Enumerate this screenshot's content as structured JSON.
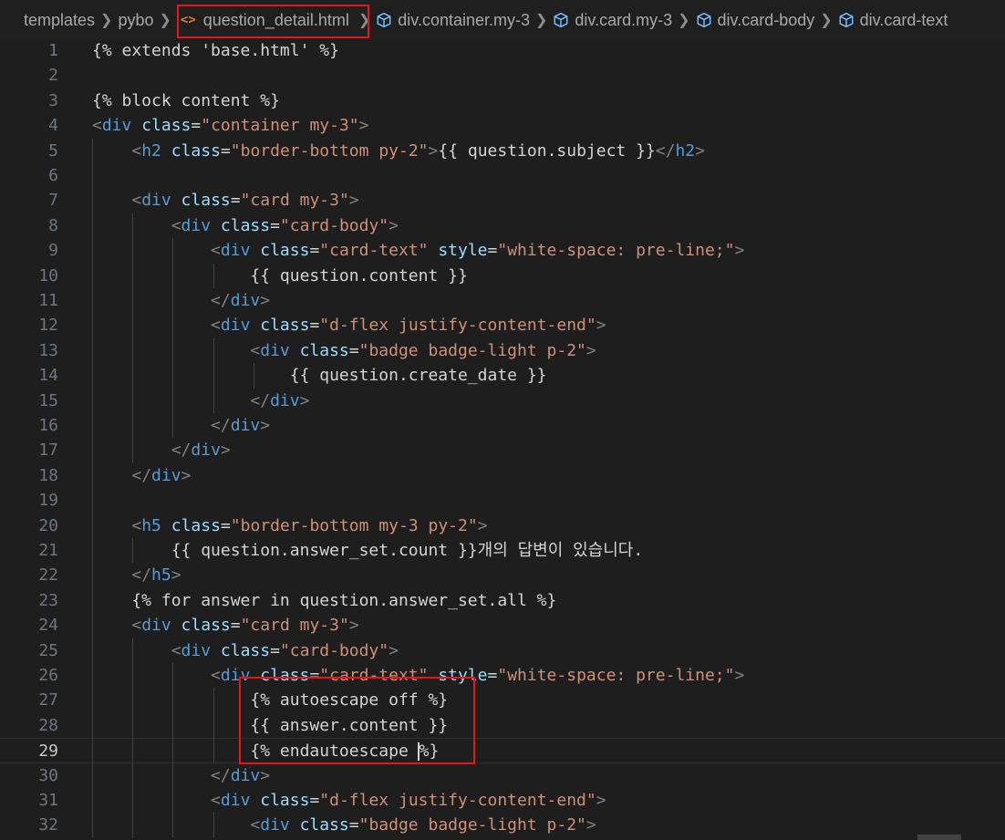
{
  "breadcrumb": {
    "items": [
      {
        "label": "templates",
        "icon": ""
      },
      {
        "label": "pybo",
        "icon": ""
      },
      {
        "label": "question_detail.html",
        "icon": "html-file-icon"
      },
      {
        "label": "div.container.my-3",
        "icon": "element-cube-icon"
      },
      {
        "label": "div.card.my-3",
        "icon": "element-cube-icon"
      },
      {
        "label": "div.card-body",
        "icon": "element-cube-icon"
      },
      {
        "label": "div.card-text",
        "icon": "element-cube-icon"
      }
    ]
  },
  "editor": {
    "active_line": 29,
    "lines": [
      {
        "n": "1",
        "tokens": [
          {
            "t": "{% extends 'base.html' %}",
            "c": "tpl"
          }
        ]
      },
      {
        "n": "2",
        "tokens": []
      },
      {
        "n": "3",
        "tokens": [
          {
            "t": "{% block content %}",
            "c": "tpl"
          }
        ]
      },
      {
        "n": "4",
        "tokens": [
          {
            "t": "<",
            "c": "ang"
          },
          {
            "t": "div",
            "c": "tag"
          },
          {
            "t": " class",
            "c": "attr"
          },
          {
            "t": "=",
            "c": "tpl"
          },
          {
            "t": "\"container my-3\"",
            "c": "str"
          },
          {
            "t": ">",
            "c": "ang"
          }
        ]
      },
      {
        "n": "5",
        "tokens": [
          {
            "t": "    ",
            "c": "tpl"
          },
          {
            "t": "<",
            "c": "ang"
          },
          {
            "t": "h2",
            "c": "tag"
          },
          {
            "t": " class",
            "c": "attr"
          },
          {
            "t": "=",
            "c": "tpl"
          },
          {
            "t": "\"border-bottom py-2\"",
            "c": "str"
          },
          {
            "t": ">",
            "c": "ang"
          },
          {
            "t": "{{ question.subject }}",
            "c": "tpl"
          },
          {
            "t": "</",
            "c": "ang"
          },
          {
            "t": "h2",
            "c": "tag"
          },
          {
            "t": ">",
            "c": "ang"
          }
        ]
      },
      {
        "n": "6",
        "tokens": []
      },
      {
        "n": "7",
        "tokens": [
          {
            "t": "    ",
            "c": "tpl"
          },
          {
            "t": "<",
            "c": "ang"
          },
          {
            "t": "div",
            "c": "tag"
          },
          {
            "t": " class",
            "c": "attr"
          },
          {
            "t": "=",
            "c": "tpl"
          },
          {
            "t": "\"card my-3\"",
            "c": "str"
          },
          {
            "t": ">",
            "c": "ang"
          }
        ]
      },
      {
        "n": "8",
        "tokens": [
          {
            "t": "        ",
            "c": "tpl"
          },
          {
            "t": "<",
            "c": "ang"
          },
          {
            "t": "div",
            "c": "tag"
          },
          {
            "t": " class",
            "c": "attr"
          },
          {
            "t": "=",
            "c": "tpl"
          },
          {
            "t": "\"card-body\"",
            "c": "str"
          },
          {
            "t": ">",
            "c": "ang"
          }
        ]
      },
      {
        "n": "9",
        "tokens": [
          {
            "t": "            ",
            "c": "tpl"
          },
          {
            "t": "<",
            "c": "ang"
          },
          {
            "t": "div",
            "c": "tag"
          },
          {
            "t": " class",
            "c": "attr"
          },
          {
            "t": "=",
            "c": "tpl"
          },
          {
            "t": "\"card-text\"",
            "c": "str"
          },
          {
            "t": " style",
            "c": "attr"
          },
          {
            "t": "=",
            "c": "tpl"
          },
          {
            "t": "\"white-space: pre-line;\"",
            "c": "str"
          },
          {
            "t": ">",
            "c": "ang"
          }
        ]
      },
      {
        "n": "10",
        "tokens": [
          {
            "t": "                {{ question.content }}",
            "c": "tpl"
          }
        ]
      },
      {
        "n": "11",
        "tokens": [
          {
            "t": "            ",
            "c": "tpl"
          },
          {
            "t": "</",
            "c": "ang"
          },
          {
            "t": "div",
            "c": "tag"
          },
          {
            "t": ">",
            "c": "ang"
          }
        ]
      },
      {
        "n": "12",
        "tokens": [
          {
            "t": "            ",
            "c": "tpl"
          },
          {
            "t": "<",
            "c": "ang"
          },
          {
            "t": "div",
            "c": "tag"
          },
          {
            "t": " class",
            "c": "attr"
          },
          {
            "t": "=",
            "c": "tpl"
          },
          {
            "t": "\"d-flex justify-content-end\"",
            "c": "str"
          },
          {
            "t": ">",
            "c": "ang"
          }
        ]
      },
      {
        "n": "13",
        "tokens": [
          {
            "t": "                ",
            "c": "tpl"
          },
          {
            "t": "<",
            "c": "ang"
          },
          {
            "t": "div",
            "c": "tag"
          },
          {
            "t": " class",
            "c": "attr"
          },
          {
            "t": "=",
            "c": "tpl"
          },
          {
            "t": "\"badge badge-light p-2\"",
            "c": "str"
          },
          {
            "t": ">",
            "c": "ang"
          }
        ]
      },
      {
        "n": "14",
        "tokens": [
          {
            "t": "                    {{ question.create_date }}",
            "c": "tpl"
          }
        ]
      },
      {
        "n": "15",
        "tokens": [
          {
            "t": "                ",
            "c": "tpl"
          },
          {
            "t": "</",
            "c": "ang"
          },
          {
            "t": "div",
            "c": "tag"
          },
          {
            "t": ">",
            "c": "ang"
          }
        ]
      },
      {
        "n": "16",
        "tokens": [
          {
            "t": "            ",
            "c": "tpl"
          },
          {
            "t": "</",
            "c": "ang"
          },
          {
            "t": "div",
            "c": "tag"
          },
          {
            "t": ">",
            "c": "ang"
          }
        ]
      },
      {
        "n": "17",
        "tokens": [
          {
            "t": "        ",
            "c": "tpl"
          },
          {
            "t": "</",
            "c": "ang"
          },
          {
            "t": "div",
            "c": "tag"
          },
          {
            "t": ">",
            "c": "ang"
          }
        ]
      },
      {
        "n": "18",
        "tokens": [
          {
            "t": "    ",
            "c": "tpl"
          },
          {
            "t": "</",
            "c": "ang"
          },
          {
            "t": "div",
            "c": "tag"
          },
          {
            "t": ">",
            "c": "ang"
          }
        ]
      },
      {
        "n": "19",
        "tokens": []
      },
      {
        "n": "20",
        "tokens": [
          {
            "t": "    ",
            "c": "tpl"
          },
          {
            "t": "<",
            "c": "ang"
          },
          {
            "t": "h5",
            "c": "tag"
          },
          {
            "t": " class",
            "c": "attr"
          },
          {
            "t": "=",
            "c": "tpl"
          },
          {
            "t": "\"border-bottom my-3 py-2\"",
            "c": "str"
          },
          {
            "t": ">",
            "c": "ang"
          }
        ]
      },
      {
        "n": "21",
        "tokens": [
          {
            "t": "        {{ question.answer_set.count }}개의 답변이 있습니다.",
            "c": "tpl"
          }
        ]
      },
      {
        "n": "22",
        "tokens": [
          {
            "t": "    ",
            "c": "tpl"
          },
          {
            "t": "</",
            "c": "ang"
          },
          {
            "t": "h5",
            "c": "tag"
          },
          {
            "t": ">",
            "c": "ang"
          }
        ]
      },
      {
        "n": "23",
        "tokens": [
          {
            "t": "    {% for answer in question.answer_set.all %}",
            "c": "tpl"
          }
        ]
      },
      {
        "n": "24",
        "tokens": [
          {
            "t": "    ",
            "c": "tpl"
          },
          {
            "t": "<",
            "c": "ang"
          },
          {
            "t": "div",
            "c": "tag"
          },
          {
            "t": " class",
            "c": "attr"
          },
          {
            "t": "=",
            "c": "tpl"
          },
          {
            "t": "\"card my-3\"",
            "c": "str"
          },
          {
            "t": ">",
            "c": "ang"
          }
        ]
      },
      {
        "n": "25",
        "tokens": [
          {
            "t": "        ",
            "c": "tpl"
          },
          {
            "t": "<",
            "c": "ang"
          },
          {
            "t": "div",
            "c": "tag"
          },
          {
            "t": " class",
            "c": "attr"
          },
          {
            "t": "=",
            "c": "tpl"
          },
          {
            "t": "\"card-body\"",
            "c": "str"
          },
          {
            "t": ">",
            "c": "ang"
          }
        ]
      },
      {
        "n": "26",
        "tokens": [
          {
            "t": "            ",
            "c": "tpl"
          },
          {
            "t": "<",
            "c": "ang"
          },
          {
            "t": "div",
            "c": "tag"
          },
          {
            "t": " class",
            "c": "attr"
          },
          {
            "t": "=",
            "c": "tpl"
          },
          {
            "t": "\"card-text\"",
            "c": "str"
          },
          {
            "t": " style",
            "c": "attr"
          },
          {
            "t": "=",
            "c": "tpl"
          },
          {
            "t": "\"white-space: pre-line;\"",
            "c": "str"
          },
          {
            "t": ">",
            "c": "ang"
          }
        ]
      },
      {
        "n": "27",
        "tokens": [
          {
            "t": "                {% autoescape off %}",
            "c": "tpl"
          }
        ]
      },
      {
        "n": "28",
        "tokens": [
          {
            "t": "                {{ answer.content }}",
            "c": "tpl"
          }
        ]
      },
      {
        "n": "29",
        "tokens": [
          {
            "t": "                {% endautoescape ",
            "c": "tpl"
          },
          {
            "t": "%}",
            "c": "tpl",
            "cursor": true
          }
        ]
      },
      {
        "n": "30",
        "tokens": [
          {
            "t": "            ",
            "c": "tpl"
          },
          {
            "t": "</",
            "c": "ang"
          },
          {
            "t": "div",
            "c": "tag"
          },
          {
            "t": ">",
            "c": "ang"
          }
        ]
      },
      {
        "n": "31",
        "tokens": [
          {
            "t": "            ",
            "c": "tpl"
          },
          {
            "t": "<",
            "c": "ang"
          },
          {
            "t": "div",
            "c": "tag"
          },
          {
            "t": " class",
            "c": "attr"
          },
          {
            "t": "=",
            "c": "tpl"
          },
          {
            "t": "\"d-flex justify-content-end\"",
            "c": "str"
          },
          {
            "t": ">",
            "c": "ang"
          }
        ]
      },
      {
        "n": "32",
        "tokens": [
          {
            "t": "                ",
            "c": "tpl"
          },
          {
            "t": "<",
            "c": "ang"
          },
          {
            "t": "div",
            "c": "tag"
          },
          {
            "t": " class",
            "c": "attr"
          },
          {
            "t": "=",
            "c": "tpl"
          },
          {
            "t": "\"badge badge-light p-2\"",
            "c": "str"
          },
          {
            "t": ">",
            "c": "ang"
          }
        ]
      }
    ]
  }
}
